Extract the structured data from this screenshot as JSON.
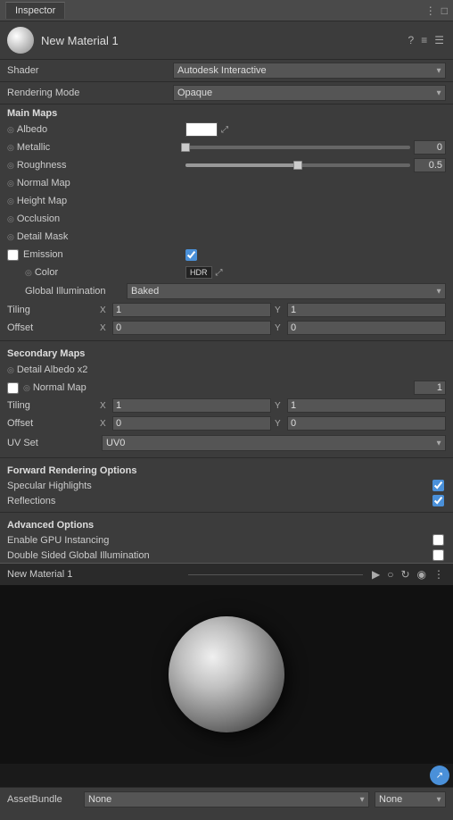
{
  "titleBar": {
    "tabLabel": "Inspector",
    "icons": [
      "=",
      "□"
    ]
  },
  "materialHeader": {
    "name": "New Material 1",
    "icons": [
      "?",
      "≡",
      "☰"
    ]
  },
  "shader": {
    "label": "Shader",
    "value": "Autodesk Interactive"
  },
  "renderingMode": {
    "label": "Rendering Mode",
    "value": "Opaque"
  },
  "mainMaps": {
    "title": "Main Maps",
    "properties": [
      {
        "name": "Albedo",
        "type": "color"
      },
      {
        "name": "Metallic",
        "type": "slider",
        "sliderPos": 0,
        "value": "0"
      },
      {
        "name": "Roughness",
        "type": "slider",
        "sliderPos": 50,
        "value": "0.5"
      },
      {
        "name": "Normal Map",
        "type": "label"
      },
      {
        "name": "Height Map",
        "type": "label"
      },
      {
        "name": "Occlusion",
        "type": "label"
      },
      {
        "name": "Detail Mask",
        "type": "label"
      }
    ]
  },
  "emission": {
    "label": "Emission",
    "colorLabel": "Color",
    "hdrLabel": "HDR",
    "giLabel": "Global Illumination",
    "giValue": "Baked"
  },
  "tiling": {
    "label": "Tiling",
    "x": "1",
    "y": "1"
  },
  "offset": {
    "label": "Offset",
    "x": "0",
    "y": "0"
  },
  "secondaryMaps": {
    "title": "Secondary Maps",
    "properties": [
      {
        "name": "Detail Albedo x2",
        "type": "label"
      },
      {
        "name": "Normal Map",
        "type": "slider",
        "value": "1"
      }
    ]
  },
  "secondaryTiling": {
    "label": "Tiling",
    "x": "1",
    "y": "1"
  },
  "secondaryOffset": {
    "label": "Offset",
    "x": "0",
    "y": "0"
  },
  "uvSet": {
    "label": "UV Set",
    "value": "UV0"
  },
  "forwardRendering": {
    "title": "Forward Rendering Options",
    "options": [
      {
        "name": "Specular Highlights",
        "checked": true
      },
      {
        "name": "Reflections",
        "checked": true
      }
    ]
  },
  "advancedOptions": {
    "title": "Advanced Options",
    "options": [
      {
        "name": "Enable GPU Instancing",
        "checked": false
      },
      {
        "name": "Double Sided Global Illumination",
        "checked": false
      }
    ]
  },
  "preview": {
    "name": "New Material 1",
    "icons": [
      "▶",
      "○",
      "↻",
      "◉",
      "⋮"
    ]
  },
  "assetBundle": {
    "label": "AssetBundle",
    "value1": "None",
    "value2": "None"
  }
}
